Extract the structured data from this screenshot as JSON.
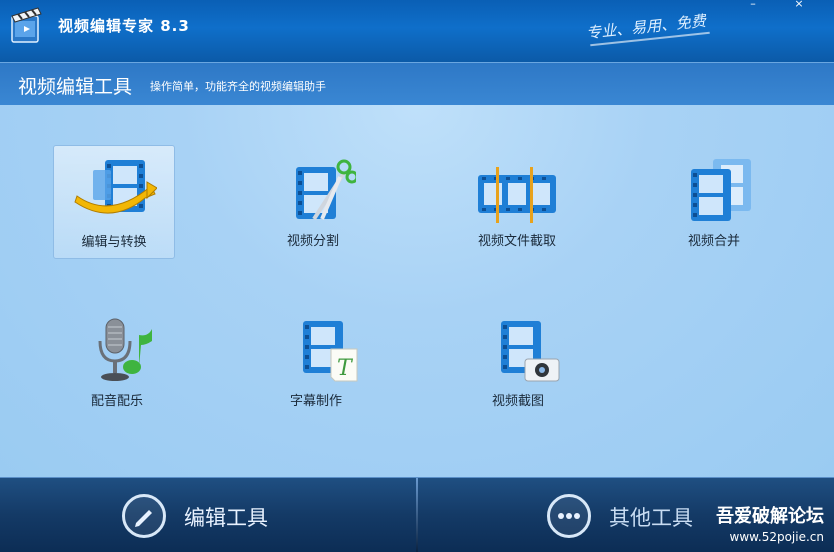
{
  "window": {
    "title": "视频编辑专家 8.3",
    "slogan": "专业、易用、免费",
    "minimize_label": "–",
    "close_label": "×"
  },
  "header": {
    "title": "视频编辑工具",
    "subtitle": "操作简单，功能齐全的视频编辑助手"
  },
  "tools": [
    {
      "label": "编辑与转换",
      "icon": "film-convert-icon",
      "selected": true
    },
    {
      "label": "视频分割",
      "icon": "film-scissors-icon"
    },
    {
      "label": "视频文件截取",
      "icon": "film-trim-icon"
    },
    {
      "label": "视频合并",
      "icon": "film-merge-icon"
    },
    {
      "label": "配音配乐",
      "icon": "microphone-music-icon"
    },
    {
      "label": "字幕制作",
      "icon": "film-subtitle-icon"
    },
    {
      "label": "视频截图",
      "icon": "film-camera-icon"
    }
  ],
  "footer": {
    "tab_edit": "编辑工具",
    "tab_other": "其他工具"
  },
  "watermark": {
    "line1": "吾爱破解论坛",
    "line2": "www.52pojie.cn"
  },
  "colors": {
    "accent": "#0f6fca",
    "film_blue": "#1f7fd6",
    "footer_bg": "#143a66"
  }
}
